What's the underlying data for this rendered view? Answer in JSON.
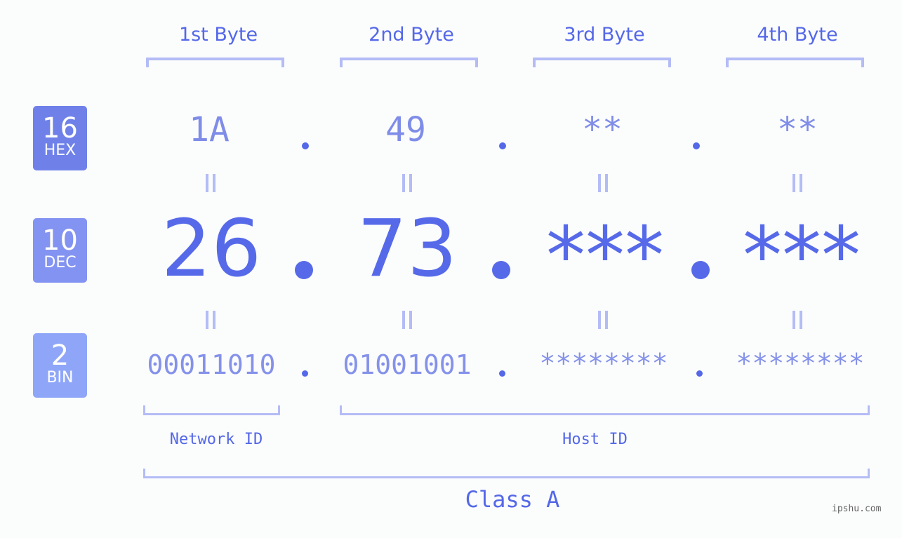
{
  "bytes": {
    "headers": [
      "1st Byte",
      "2nd Byte",
      "3rd Byte",
      "4th Byte"
    ]
  },
  "badges": {
    "hex": {
      "base": "16",
      "label": "HEX",
      "color": "#6f81e9"
    },
    "dec": {
      "base": "10",
      "label": "DEC",
      "color": "#8393f2"
    },
    "bin": {
      "base": "2",
      "label": "BIN",
      "color": "#8fa6f8"
    }
  },
  "hex_values": [
    "1A",
    "49",
    "**",
    "**"
  ],
  "dec_values": [
    "26",
    "73",
    "***",
    "***"
  ],
  "bin_values": [
    "00011010",
    "01001001",
    "********",
    "********"
  ],
  "separators": {
    "dot": "."
  },
  "labels": {
    "network_id": "Network ID",
    "host_id": "Host ID",
    "class": "Class A"
  },
  "watermark": "ipshu.com",
  "colors": {
    "accent": "#5468e8",
    "bracket": "#b4bcf6",
    "hex_text": "#7f8de8",
    "bin_text": "#8592ea"
  }
}
